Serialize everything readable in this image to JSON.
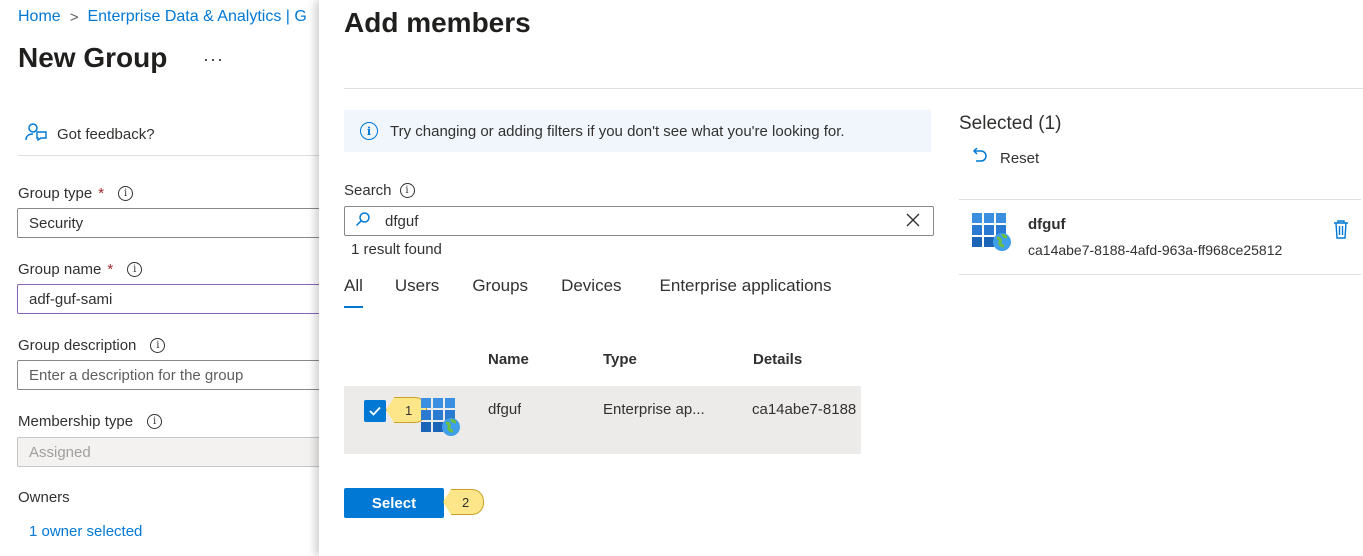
{
  "breadcrumb": {
    "home": "Home",
    "sep": ">",
    "current": "Enterprise Data & Analytics | G"
  },
  "page": {
    "title": "New Group",
    "more": "···"
  },
  "feedback": {
    "label": "Got feedback?"
  },
  "form": {
    "group_type_label": "Group type",
    "group_type_value": "Security",
    "group_name_label": "Group name",
    "group_name_value": "adf-guf-sami",
    "description_label": "Group description",
    "description_placeholder": "Enter a description for the group",
    "membership_label": "Membership type",
    "membership_value": "Assigned",
    "owners_label": "Owners",
    "owners_link": "1 owner selected",
    "required_mark": "*",
    "info_glyph": "i"
  },
  "panel": {
    "title": "Add members",
    "info_text": "Try changing or adding filters if you don't see what you're looking for.",
    "search_label": "Search",
    "search_value": "dfguf",
    "result_count": "1 result found",
    "tabs": [
      "All",
      "Users",
      "Groups",
      "Devices",
      "Enterprise applications"
    ],
    "columns": {
      "name": "Name",
      "type": "Type",
      "details": "Details"
    },
    "row": {
      "name": "dfguf",
      "type": "Enterprise ap...",
      "details": "ca14abe7-8188"
    },
    "callout_1": "1",
    "callout_2": "2",
    "select_button": "Select"
  },
  "selected": {
    "title": "Selected (1)",
    "reset": "Reset",
    "item_name": "dfguf",
    "item_id": "ca14abe7-8188-4afd-963a-ff968ce25812"
  },
  "colors": {
    "accent": "#0078d4",
    "callout": "#fde68a",
    "required": "#a4262c"
  }
}
